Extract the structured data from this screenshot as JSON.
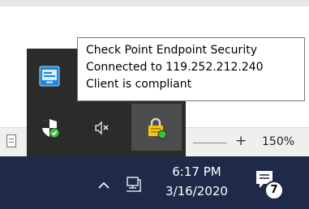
{
  "tooltip": {
    "line1": "Check Point Endpoint Security",
    "line2": "Connected to 119.252.212.240",
    "line3": "Client is compliant"
  },
  "statusbar": {
    "zoom_plus": "+",
    "zoom_label": "150%"
  },
  "tray_flyout": {
    "icons": [
      "checkpoint-client-icon",
      "windows-security-icon",
      "volume-muted-icon",
      "checkpoint-vpn-lock-icon"
    ]
  },
  "taskbar": {
    "time": "6:17 PM",
    "date": "3/16/2020",
    "notification_count": "7"
  },
  "colors": {
    "taskbar_bg": "#1f2a49",
    "flyout_bg": "#2b2b2b",
    "vpn_lock_yellow": "#f2c811",
    "status_green": "#3cbf3c"
  }
}
